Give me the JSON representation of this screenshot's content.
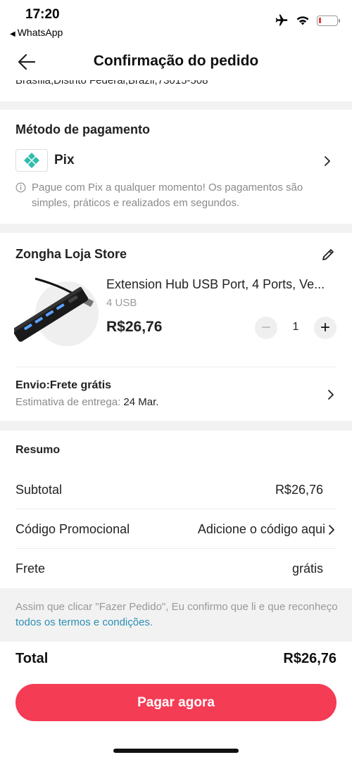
{
  "status_bar": {
    "time": "17:20",
    "back_app": "WhatsApp",
    "icons": [
      "airplane-icon",
      "wifi-icon",
      "battery-icon"
    ],
    "battery_level": 0.12,
    "battery_color": "#e83a3a"
  },
  "header": {
    "title": "Confirmação do pedido"
  },
  "address": {
    "partial_text": "Brasília,Distrito Federal,Brazil,73015-508"
  },
  "payment": {
    "section_title": "Método de pagamento",
    "method_name": "Pix",
    "info": "Pague com Pix a qualquer momento! Os pagamentos são simples, práticos e realizados em segundos.",
    "brand_color": "#32bcad"
  },
  "store": {
    "name": "Zongha Loja Store",
    "product": {
      "title": "Extension Hub USB Port, 4 Ports, Ve...",
      "variant": "4 USB",
      "price": "R$26,76",
      "quantity": "1",
      "minus_label": "−",
      "plus_label": "+"
    },
    "shipping": {
      "title": "Envio:Frete grátis",
      "estimate_label": "Estimativa de entrega:",
      "estimate_date": "24 Mar."
    }
  },
  "summary": {
    "title": "Resumo",
    "subtotal_label": "Subtotal",
    "subtotal_value": "R$26,76",
    "promo_label": "Código Promocional",
    "promo_value": "Adicione o código aqui",
    "shipping_label": "Frete",
    "shipping_value": "grátis"
  },
  "terms": {
    "text": "Assim que clicar \"Fazer Pedido\", Eu confirmo que li e que reconheço ",
    "link": "todos os termos e condições."
  },
  "total": {
    "label": "Total",
    "value": "R$26,76"
  },
  "pay_button": {
    "label": "Pagar agora",
    "color": "#f53c55"
  }
}
